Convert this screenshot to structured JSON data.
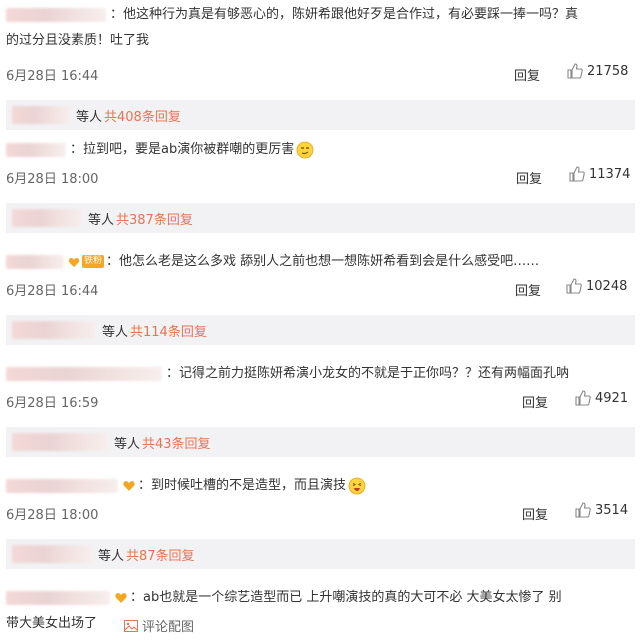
{
  "comments": [
    {
      "text_line1": "：他这种行为真是有够恶心的，陈妍希跟他好歹是合作过，有必要踩一捧一吗？真",
      "text_line2": "的过分且没素质！吐了我",
      "time": "6月28日 16:44",
      "reply_label": "回复",
      "likes": "21758",
      "replies_who": "等人",
      "replies_count": "共408条回复"
    },
    {
      "text_line1": "：拉到吧，要是ab演你被群嘲的更厉害",
      "time": "6月28日 18:00",
      "reply_label": "回复",
      "likes": "11374",
      "replies_who": "等人",
      "replies_count": "共387条回复"
    },
    {
      "badge": "铁粉",
      "text_line1": "：他怎么老是这么多戏 舔别人之前也想一想陈妍希看到会是什么感受吧……",
      "time": "6月28日 16:44",
      "reply_label": "回复",
      "likes": "10248",
      "replies_who": "等人",
      "replies_count": "共114条回复"
    },
    {
      "text_line1": "：记得之前力挺陈妍希演小龙女的不就是于正你吗？？还有两幅面孔呐",
      "time": "6月28日 16:59",
      "reply_label": "回复",
      "likes": "4921",
      "replies_who": "等人",
      "replies_count": "共43条回复"
    },
    {
      "text_line1": "：到时候吐槽的不是造型，而且演技",
      "time": "6月28日 18:00",
      "reply_label": "回复",
      "likes": "3514",
      "replies_who": "等人",
      "replies_count": "共87条回复"
    },
    {
      "text_line1": "：ab也就是一个综艺造型而已 上升嘲演技的真的大可不必 大美女太惨了  别",
      "text_line2": "带大美女出场了"
    }
  ],
  "bottom_link": "评论配图",
  "colors": {
    "accent": "#eb7350",
    "reply_bg": "#f2f2f5",
    "fan_badge": "#f5a623"
  },
  "icons": {
    "like": "thumbs-up-icon",
    "image": "image-icon",
    "fan": "fan-heart-icon"
  }
}
